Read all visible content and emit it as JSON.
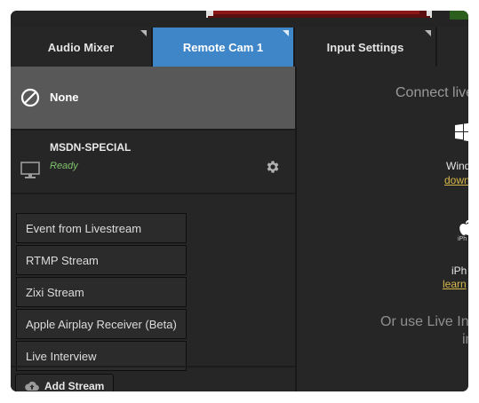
{
  "tabs": [
    {
      "label": "Audio Mixer",
      "active": false
    },
    {
      "label": "Remote Cam 1",
      "active": true
    },
    {
      "label": "Input Settings",
      "active": false
    }
  ],
  "sources": {
    "none_label": "None",
    "items": [
      {
        "name": "MSDN-SPECIAL",
        "status": "Ready"
      }
    ]
  },
  "stream_menu": {
    "items": [
      "Event from Livestream",
      "RTMP Stream",
      "Zixi Stream",
      "Apple Airplay Receiver (Beta)",
      "Live Interview"
    ],
    "add_button_label": "Add Stream"
  },
  "connect_panel": {
    "heading": "Connect live",
    "windows_label": "Windo",
    "windows_link": "down",
    "iphone_caption": "iPh",
    "iphone_label": "iPh",
    "iphone_link": "learn",
    "or_use_text": "Or use Live Int",
    "in_text": "in"
  },
  "colors": {
    "accent": "#3f86c8",
    "ready": "#7fc36a",
    "link": "#d6b84a",
    "selected_row": "#585858"
  }
}
